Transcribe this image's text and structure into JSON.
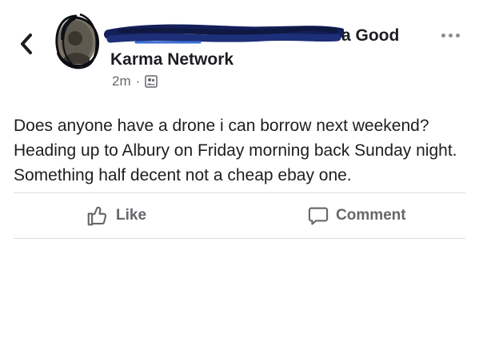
{
  "post": {
    "group_name_tail": "a Good",
    "group_name_line2": "Karma Network",
    "timestamp": "2m",
    "separator": "·",
    "visibility_icon": "group-members-icon",
    "body": "Does anyone have a drone i can borrow next weekend? Heading up to Albury on Friday morning back Sunday night. Something half decent not a cheap ebay one."
  },
  "actions": {
    "like_label": "Like",
    "comment_label": "Comment"
  },
  "icons": {
    "back": "chevron-left-icon",
    "more": "more-options-icon",
    "like": "thumbs-up-icon",
    "comment": "comment-bubble-icon"
  },
  "colors": {
    "text_primary": "#1c1e21",
    "text_secondary": "#65676b",
    "redaction": "#1b2a5a",
    "divider": "#dadde1"
  }
}
